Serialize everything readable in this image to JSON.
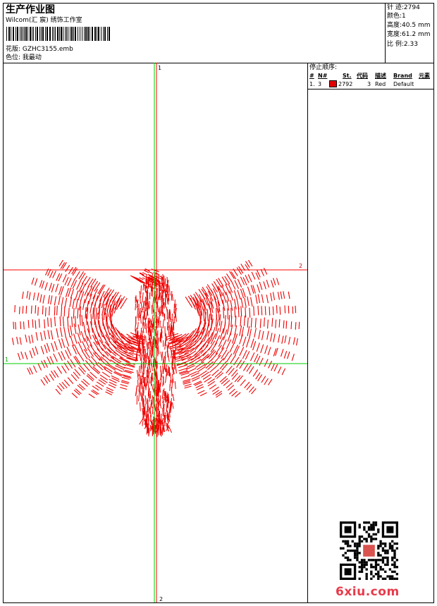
{
  "header": {
    "title": "生产作业图",
    "subtitle": "Wilcom(汇 宸) 绣饰工作室",
    "design_label": "花版:",
    "design_value": "GZHC3155.emb",
    "color_label": "色位:",
    "color_value": "我最动"
  },
  "stats": [
    {
      "label": "针 迹:",
      "value": "2794"
    },
    {
      "label": "颜色:",
      "value": "1"
    },
    {
      "label": "高度:",
      "value": "40.5 mm"
    },
    {
      "label": "宽度:",
      "value": "61.2 mm"
    },
    {
      "label": "比 例:",
      "value": "2.33"
    }
  ],
  "canvas": {
    "axis_labels": {
      "top": "1",
      "bottom": "2",
      "left": "1",
      "right": "2"
    }
  },
  "panel": {
    "title": "停止顺序:",
    "columns": [
      "#",
      "N#",
      "St.",
      "代码",
      "描述",
      "Brand",
      "元素"
    ],
    "rows": [
      {
        "num": "1.",
        "needle": "3",
        "stitches": "2792",
        "code": "3",
        "description": "Red",
        "brand": "Default",
        "color": "#e00000"
      }
    ]
  },
  "colors": {
    "thread": "#ee0000",
    "guide_green": "#00cc00",
    "guide_red": "#ff0000",
    "brand": "#e83a4a"
  },
  "watermark": {
    "text": "6xiu.com"
  }
}
